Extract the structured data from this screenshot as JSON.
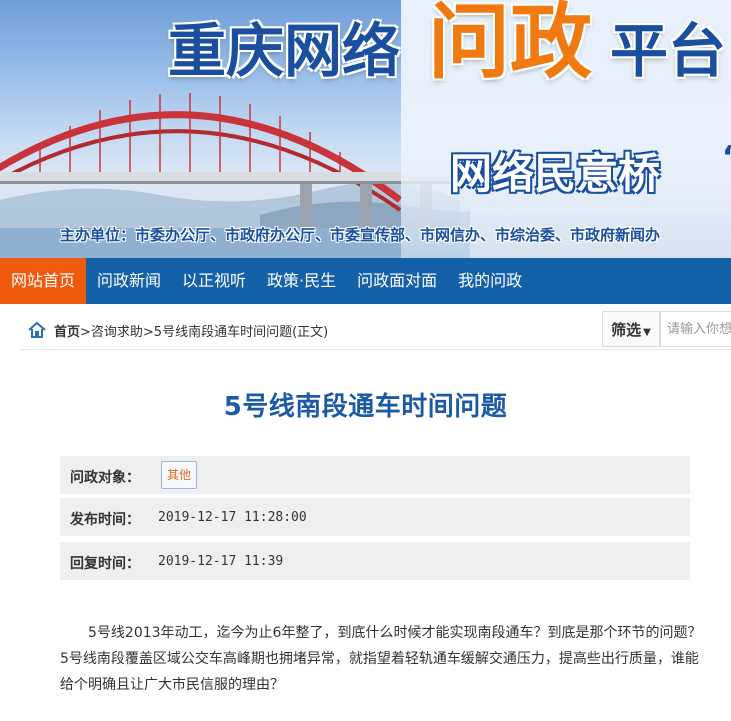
{
  "banner": {
    "title_part1": "重庆网络",
    "title_part2": "问政",
    "title_part3": "平台",
    "subtitle": "网络民意桥",
    "subtitle_mark": "“",
    "organizers": "主办单位：市委办公厅、市政府办公厅、市委宣传部、市网信办、市综治委、市政府新闻办"
  },
  "nav": {
    "items": [
      {
        "label": "网站首页"
      },
      {
        "label": "问政新闻"
      },
      {
        "label": "以正视听"
      },
      {
        "label": "政策·民生"
      },
      {
        "label": "问政面对面"
      },
      {
        "label": "我的问政"
      }
    ]
  },
  "breadcrumb": {
    "home": "首页",
    "rest": ">咨询求助>5号线南段通车时间问题(正文)"
  },
  "search": {
    "filter_label": "筛选",
    "placeholder": "请输入你想"
  },
  "article": {
    "title": "5号线南段通车时间问题",
    "meta": {
      "target_label": "问政对象：",
      "target_value": "其他",
      "published_label": "发布时间：",
      "published_value": "2019-12-17 11:28:00",
      "replied_label": "回复时间：",
      "replied_value": "2019-12-17 11:39"
    },
    "body": "5号线2013年动工，迄今为止6年整了，到底什么时候才能实现南段通车？到底是那个环节的问题？5号线南段覆盖区域公交车高峰期也拥堵异常，就指望着轻轨通车缓解交通压力，提高些出行质量，谁能给个明确且让广大市民信服的理由？"
  },
  "colors": {
    "nav_bg": "#1561a8",
    "nav_active": "#ef5a0c",
    "title_blue": "#1c5aa6",
    "banner_orange": "#f07a10"
  }
}
